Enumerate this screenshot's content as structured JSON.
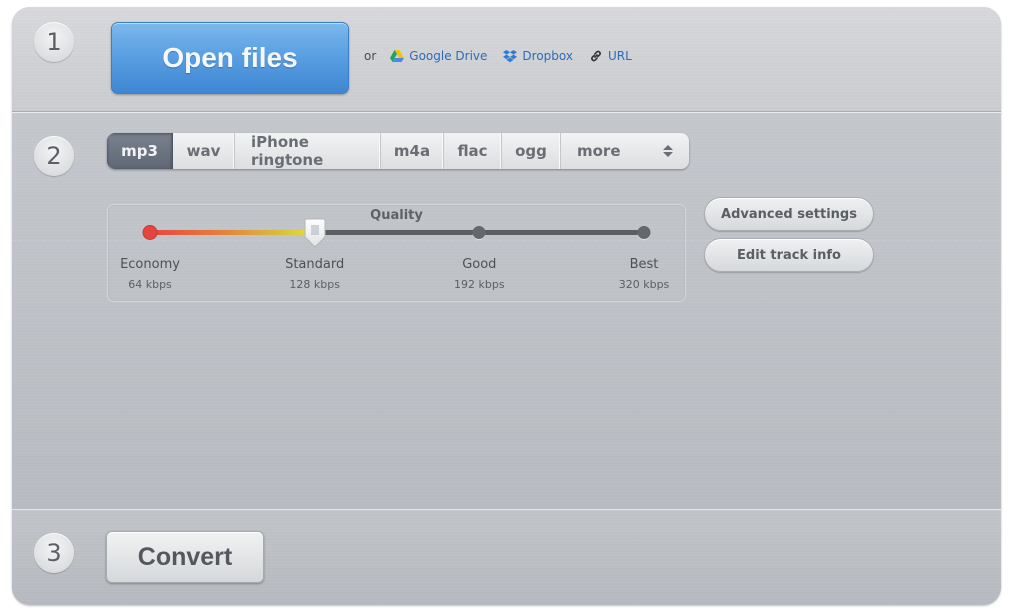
{
  "step1": {
    "number": "1",
    "open_files_label": "Open files",
    "or_label": "or",
    "sources": [
      {
        "label": "Google Drive",
        "icon": "google-drive-icon"
      },
      {
        "label": "Dropbox",
        "icon": "dropbox-icon"
      },
      {
        "label": "URL",
        "icon": "link-icon"
      }
    ]
  },
  "step2": {
    "number": "2",
    "formats": [
      {
        "label": "mp3",
        "active": true
      },
      {
        "label": "wav",
        "active": false
      },
      {
        "label": "iPhone ringtone",
        "active": false
      },
      {
        "label": "m4a",
        "active": false
      },
      {
        "label": "flac",
        "active": false
      },
      {
        "label": "ogg",
        "active": false
      }
    ],
    "more_label": "more",
    "quality": {
      "title": "Quality",
      "selected_index": 1,
      "levels": [
        {
          "name": "Economy",
          "rate": "64 kbps"
        },
        {
          "name": "Standard",
          "rate": "128 kbps"
        },
        {
          "name": "Good",
          "rate": "192 kbps"
        },
        {
          "name": "Best",
          "rate": "320 kbps"
        }
      ]
    },
    "advanced_settings_label": "Advanced settings",
    "edit_track_info_label": "Edit track info"
  },
  "step3": {
    "number": "3",
    "convert_label": "Convert"
  },
  "colors": {
    "primary_button": "#4a93db",
    "link": "#2f6ab8",
    "active_tab": "#6b7380"
  }
}
